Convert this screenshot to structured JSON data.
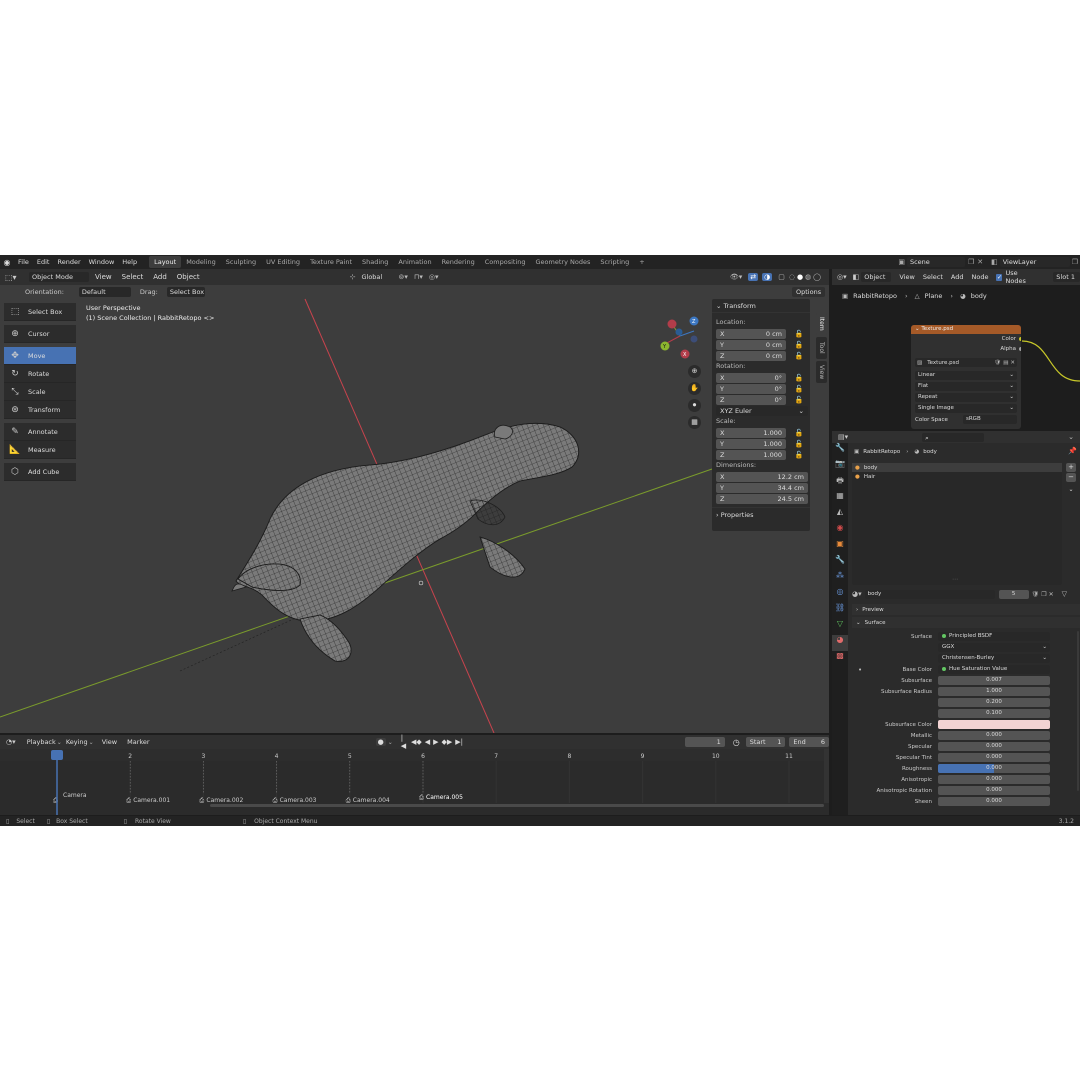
{
  "topbar": {
    "menu": [
      "File",
      "Edit",
      "Render",
      "Window",
      "Help"
    ],
    "workspaces": [
      "Layout",
      "Modeling",
      "Sculpting",
      "UV Editing",
      "Texture Paint",
      "Shading",
      "Animation",
      "Rendering",
      "Compositing",
      "Geometry Nodes",
      "Scripting"
    ],
    "active_workspace": "Layout",
    "add_tab": "+",
    "scene": "Scene",
    "view_layer": "ViewLayer"
  },
  "viewport": {
    "mode": "Object Mode",
    "menu": [
      "View",
      "Select",
      "Add",
      "Object"
    ],
    "transform_orientation": "Global",
    "orientation_label": "Orientation:",
    "orientation_value": "Default",
    "drag_label": "Drag:",
    "drag_value": "Select Box",
    "options": "Options",
    "overlay_title": "User Perspective",
    "overlay_subtitle": "(1) Scene Collection | RabbitRetopo <>",
    "gizmo": {
      "x": "X",
      "y": "Y",
      "z": "Z"
    }
  },
  "toolbar": {
    "tools": [
      {
        "label": "Select Box",
        "icon": "select-box-icon"
      },
      {
        "label": "Cursor",
        "icon": "cursor-icon"
      },
      {
        "label": "Move",
        "icon": "move-icon"
      },
      {
        "label": "Rotate",
        "icon": "rotate-icon"
      },
      {
        "label": "Scale",
        "icon": "scale-icon"
      },
      {
        "label": "Transform",
        "icon": "transform-icon"
      },
      {
        "label": "Annotate",
        "icon": "annotate-icon"
      },
      {
        "label": "Measure",
        "icon": "measure-icon"
      },
      {
        "label": "Add Cube",
        "icon": "add-cube-icon"
      }
    ],
    "active": "Move"
  },
  "npanel": {
    "title": "Transform",
    "location_label": "Location:",
    "location": [
      {
        "axis": "X",
        "value": "0 cm"
      },
      {
        "axis": "Y",
        "value": "0 cm"
      },
      {
        "axis": "Z",
        "value": "0 cm"
      }
    ],
    "rotation_label": "Rotation:",
    "rotation": [
      {
        "axis": "X",
        "value": "0°"
      },
      {
        "axis": "Y",
        "value": "0°"
      },
      {
        "axis": "Z",
        "value": "0°"
      }
    ],
    "rotation_mode": "XYZ Euler",
    "scale_label": "Scale:",
    "scale": [
      {
        "axis": "X",
        "value": "1.000"
      },
      {
        "axis": "Y",
        "value": "1.000"
      },
      {
        "axis": "Z",
        "value": "1.000"
      }
    ],
    "dimensions_label": "Dimensions:",
    "dimensions": [
      {
        "axis": "X",
        "value": "12.2 cm"
      },
      {
        "axis": "Y",
        "value": "34.4 cm"
      },
      {
        "axis": "Z",
        "value": "24.5 cm"
      }
    ],
    "properties": "Properties",
    "tabs": [
      "Item",
      "Tool",
      "View"
    ]
  },
  "timeline": {
    "menu": [
      "Playback",
      "Keying",
      "View",
      "Marker"
    ],
    "current_frame": "1",
    "start_label": "Start",
    "start": "1",
    "end_label": "End",
    "end": "6",
    "frames": [
      "1",
      "2",
      "3",
      "4",
      "5",
      "6",
      "7",
      "8",
      "9",
      "10",
      "11"
    ],
    "markers": [
      "Camera",
      "Camera.001",
      "Camera.002",
      "Camera.003",
      "Camera.004",
      "Camera.005"
    ]
  },
  "statusbar": {
    "items": [
      "Select",
      "Box Select",
      "Rotate View",
      "Object Context Menu"
    ],
    "version": "3.1.2"
  },
  "node_editor": {
    "header": {
      "object": "Object",
      "menu": [
        "View",
        "Select",
        "Add",
        "Node"
      ],
      "use_nodes": "Use Nodes",
      "slot": "Slot 1"
    },
    "breadcrumb": [
      "RabbitRetopo",
      "Plane",
      "body"
    ],
    "node": {
      "title": "Texture.psd",
      "outputs": [
        "Color",
        "Alpha"
      ],
      "image": "Texture.psd",
      "interpolation": "Linear",
      "projection": "Flat",
      "extension": "Repeat",
      "source": "Single Image",
      "color_space_label": "Color Space",
      "color_space": "sRGB"
    }
  },
  "properties": {
    "breadcrumb": [
      "RabbitRetopo",
      "body"
    ],
    "slots": [
      "body",
      "Hair"
    ],
    "material": "body",
    "users": "5",
    "preview": "Preview",
    "surface": "Surface",
    "rows": [
      {
        "label": "Surface",
        "value": "Principled BSDF",
        "kind": "socket"
      },
      {
        "label": "",
        "value": "GGX",
        "kind": "dropdown"
      },
      {
        "label": "",
        "value": "Christensen-Burley",
        "kind": "dropdown"
      },
      {
        "label": "Base Color",
        "value": "Hue Saturation Value",
        "kind": "socket"
      },
      {
        "label": "Subsurface",
        "value": "0.007",
        "kind": "num"
      },
      {
        "label": "Subsurface Radius",
        "value": "1.000",
        "kind": "num"
      },
      {
        "label": "",
        "value": "0.200",
        "kind": "num"
      },
      {
        "label": "",
        "value": "0.100",
        "kind": "num"
      },
      {
        "label": "Subsurface Color",
        "value": "",
        "kind": "color"
      },
      {
        "label": "Metallic",
        "value": "0.000",
        "kind": "num"
      },
      {
        "label": "Specular",
        "value": "0.000",
        "kind": "num"
      },
      {
        "label": "Specular Tint",
        "value": "0.000",
        "kind": "num"
      },
      {
        "label": "Roughness",
        "value": "0.000",
        "kind": "bar"
      },
      {
        "label": "Anisotropic",
        "value": "0.000",
        "kind": "num"
      },
      {
        "label": "Anisotropic Rotation",
        "value": "0.000",
        "kind": "num"
      },
      {
        "label": "Sheen",
        "value": "0.000",
        "kind": "num"
      }
    ]
  },
  "colors": {
    "accent": "#4772b3",
    "x_axis": "#ff3352",
    "y_axis": "#8bdc00",
    "z_axis": "#2890ff",
    "node_header": "#a55a28",
    "subsurface_color": "#f2d3d3",
    "connection": "#c7c729"
  }
}
